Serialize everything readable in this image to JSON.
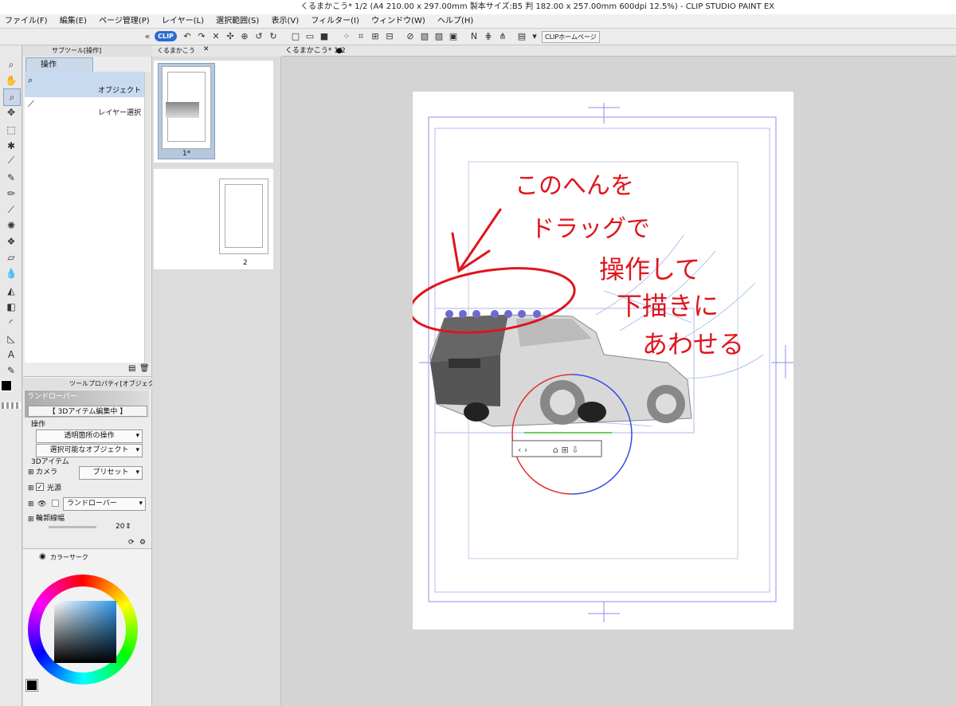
{
  "window": {
    "title": "くるまかこう* 1/2 (A4 210.00 x 297.00mm 製本サイズ:B5 判 182.00 x 257.00mm 600dpi 12.5%) - CLIP STUDIO PAINT EX"
  },
  "menu": [
    "ファイル(F)",
    "編集(E)",
    "ページ管理(P)",
    "レイヤー(L)",
    "選択範囲(S)",
    "表示(V)",
    "フィルター(I)",
    "ウィンドウ(W)",
    "ヘルプ(H)"
  ],
  "toolbar": {
    "clip_badge": "CLIP",
    "home_button": "CLIPホームページ"
  },
  "subtool": {
    "tab_label": "サブツール[操作]",
    "group_button": "操作",
    "items": [
      "オブジェクト",
      "レイヤー選択"
    ]
  },
  "toolprop": {
    "tab_label": "ツールプロパティ[オブジェクト]",
    "object_name": "ランドローバー",
    "status": "【 3Dアイテム編集中 】",
    "operation_label": "操作",
    "transparent_op": "透明箇所の操作",
    "selectable_obj": "選択可能なオブジェクト",
    "item_section": "3Dアイテム",
    "camera_label": "カメラ",
    "preset_label": "プリセット",
    "light_label": "光源",
    "model_name": "ランドローバー",
    "outline_label": "輪郭線幅",
    "outline_value": "20"
  },
  "color": {
    "tab_label": "カラーサーク"
  },
  "pages": {
    "tab_label": "くるまかこう",
    "page1_label": "1*",
    "page2_label": "2"
  },
  "canvas": {
    "tab_label": "くるまかこう* 1/2",
    "annotation_lines": [
      "このへんを",
      "ドラッグで",
      "操作して",
      "下描きに",
      "あわせる"
    ]
  },
  "colors": {
    "accent": "#2a6ccf",
    "annotation": "#e0141e",
    "guide": "#8c8cf0"
  }
}
